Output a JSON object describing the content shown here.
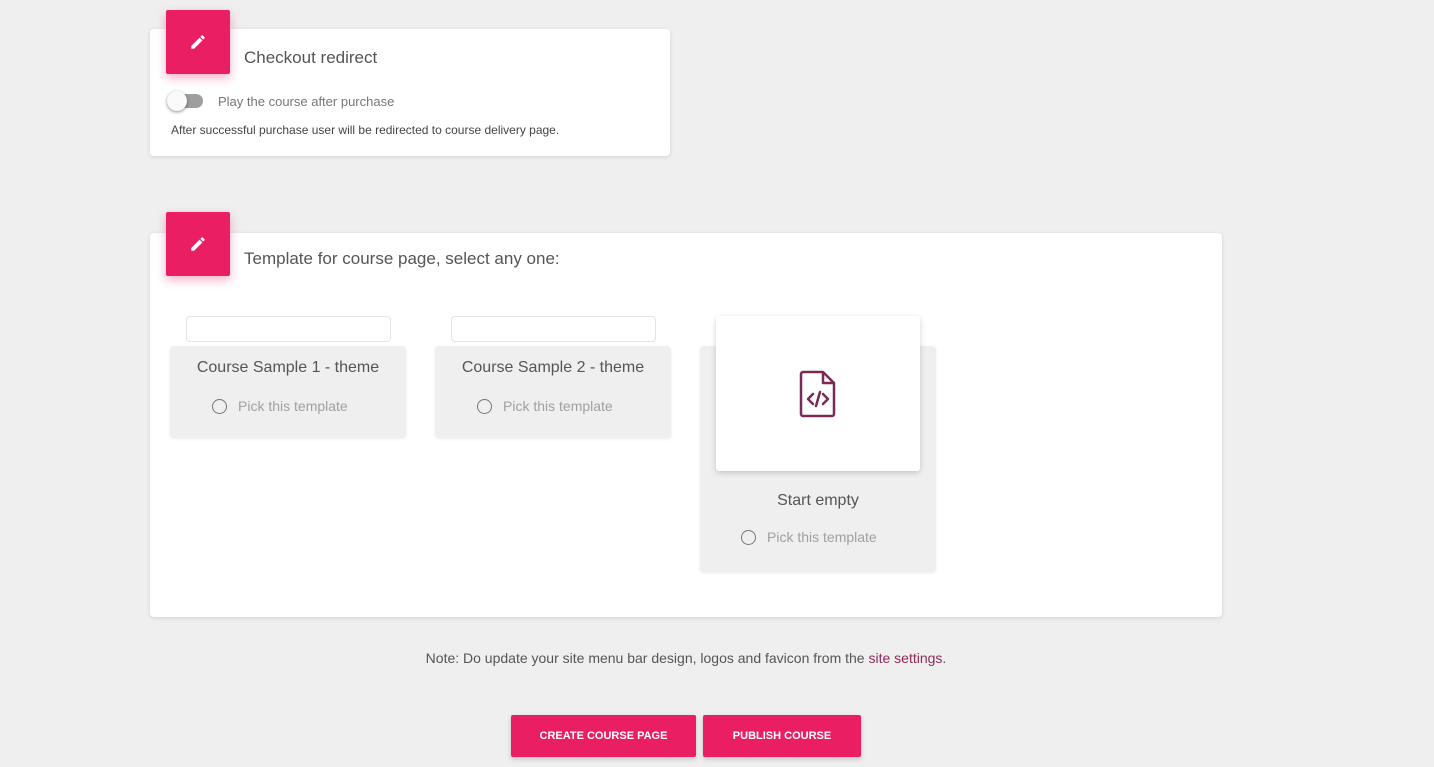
{
  "checkout": {
    "title": "Checkout redirect",
    "toggle_label": "Play the course after purchase",
    "toggle_on": false,
    "help_text": "After successful purchase user will be redirected to course delivery page."
  },
  "templates": {
    "title": "Template for course page, select any one:",
    "items": [
      {
        "name": "Course Sample 1 - theme",
        "pick_label": "Pick this template"
      },
      {
        "name": "Course Sample 2 - theme",
        "pick_label": "Pick this template"
      },
      {
        "name": "Start empty",
        "pick_label": "Pick this template",
        "icon": "code-file-icon"
      }
    ]
  },
  "note": {
    "text": "Note: Do update your site menu bar design, logos and favicon from the ",
    "link_text": "site settings",
    "suffix": "."
  },
  "buttons": {
    "create": "CREATE COURSE PAGE",
    "publish": "PUBLISH COURSE"
  },
  "colors": {
    "accent": "#e91e63",
    "link": "#8e2a5a",
    "background": "#efefef"
  }
}
